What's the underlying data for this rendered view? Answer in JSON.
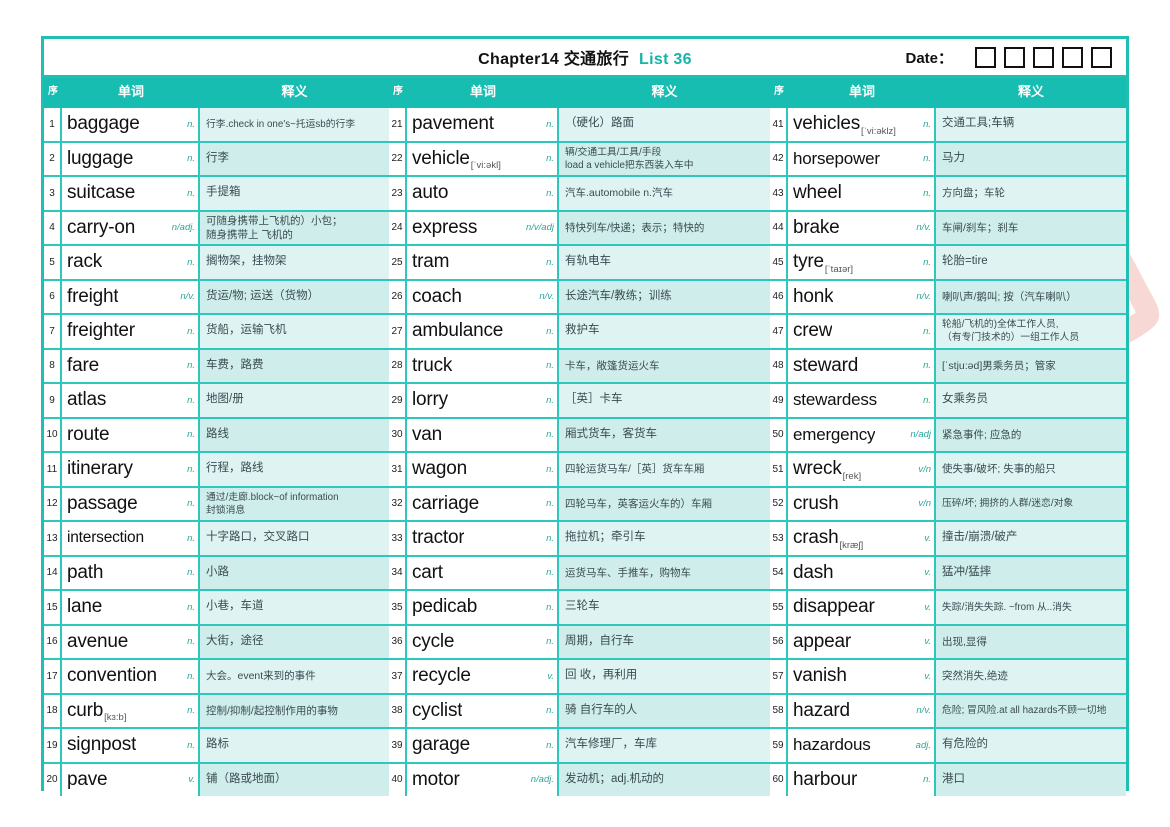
{
  "header": {
    "title_main": "Chapter14 交通旅行",
    "list_label": "List 36",
    "date_label": "Date：",
    "date_box_count": 5,
    "accent_color": "#16bdb0",
    "title_color": "#111111"
  },
  "column_headers": {
    "index": "序",
    "word": "单词",
    "definition": "释义"
  },
  "watermark": {
    "line1": "试用水印",
    "line2": "WPS"
  },
  "columns": [
    {
      "rows": [
        {
          "no": "1",
          "word": "baggage",
          "phonetic": "",
          "pos": "n.",
          "def": "行李.check in one's~托运sb的行李",
          "def_size": "tiny"
        },
        {
          "no": "2",
          "word": "luggage",
          "phonetic": "",
          "pos": "n.",
          "def": "行李",
          "def_size": ""
        },
        {
          "no": "3",
          "word": "suitcase",
          "phonetic": "",
          "pos": "n.",
          "def": "手提箱",
          "def_size": ""
        },
        {
          "no": "4",
          "word": "carry-on",
          "phonetic": "",
          "pos": "n/adj.",
          "def": "可随身携带上飞机的）小包；\n随身携带上 飞机的",
          "def_size": "small"
        },
        {
          "no": "5",
          "word": "rack",
          "phonetic": "",
          "pos": "n.",
          "def": "搁物架，挂物架",
          "def_size": ""
        },
        {
          "no": "6",
          "word": "freight",
          "phonetic": "",
          "pos": "n/v.",
          "def": "货运/物; 运送（货物）",
          "def_size": ""
        },
        {
          "no": "7",
          "word": "freighter",
          "phonetic": "",
          "pos": "n.",
          "def": "货船，运输飞机",
          "def_size": ""
        },
        {
          "no": "8",
          "word": "fare",
          "phonetic": "",
          "pos": "n.",
          "def": "车费，路费",
          "def_size": ""
        },
        {
          "no": "9",
          "word": "atlas",
          "phonetic": "",
          "pos": "n.",
          "def": "地图/册",
          "def_size": ""
        },
        {
          "no": "10",
          "word": "route",
          "phonetic": "",
          "pos": "n.",
          "def": "路线",
          "def_size": ""
        },
        {
          "no": "11",
          "word": "itinerary",
          "phonetic": "",
          "pos": "n.",
          "def": "行程，路线",
          "def_size": ""
        },
        {
          "no": "12",
          "word": "passage",
          "phonetic": "",
          "pos": "n.",
          "def": "通过/走廊.block~of information\n封锁消息",
          "def_size": "tiny"
        },
        {
          "no": "13",
          "word": "intersection",
          "phonetic": "",
          "pos": "n.",
          "def": "十字路口，交叉路口",
          "def_size": "",
          "word_size": "shrink2"
        },
        {
          "no": "14",
          "word": "path",
          "phonetic": "",
          "pos": "n.",
          "def": "小路",
          "def_size": ""
        },
        {
          "no": "15",
          "word": "lane",
          "phonetic": "",
          "pos": "n.",
          "def": "小巷，车道",
          "def_size": ""
        },
        {
          "no": "16",
          "word": "avenue",
          "phonetic": "",
          "pos": "n.",
          "def": "大街，途径",
          "def_size": ""
        },
        {
          "no": "17",
          "word": "convention",
          "phonetic": "",
          "pos": "n.",
          "def": "大会。event来到的事件",
          "def_size": "small"
        },
        {
          "no": "18",
          "word": "curb",
          "phonetic": "[kɜ:b]",
          "pos": "n.",
          "def": "控制/抑制/起控制作用的事物",
          "def_size": "small"
        },
        {
          "no": "19",
          "word": "signpost",
          "phonetic": "",
          "pos": "n.",
          "def": "路标",
          "def_size": ""
        },
        {
          "no": "20",
          "word": "pave",
          "phonetic": "",
          "pos": "v.",
          "def": "铺（路或地面）",
          "def_size": ""
        }
      ]
    },
    {
      "rows": [
        {
          "no": "21",
          "word": "pavement",
          "phonetic": "",
          "pos": "n.",
          "def": "（硬化）路面",
          "def_size": ""
        },
        {
          "no": "22",
          "word": "vehicle",
          "phonetic": "[ˈvi:əkl]",
          "pos": "n.",
          "def": "辆/交通工具/工具/手段\nload a vehicle把东西装入车中",
          "def_size": "tiny"
        },
        {
          "no": "23",
          "word": "auto",
          "phonetic": "",
          "pos": "n.",
          "def": "汽车.automobile n.汽车",
          "def_size": "small"
        },
        {
          "no": "24",
          "word": "express",
          "phonetic": "",
          "pos": "n/v/adj",
          "def": "特快列车/快递；表示；特快的",
          "def_size": "small"
        },
        {
          "no": "25",
          "word": "tram",
          "phonetic": "",
          "pos": "n.",
          "def": "有轨电车",
          "def_size": ""
        },
        {
          "no": "26",
          "word": "coach",
          "phonetic": "",
          "pos": "n/v.",
          "def": "长途汽车/教练；训练",
          "def_size": ""
        },
        {
          "no": "27",
          "word": "ambulance",
          "phonetic": "",
          "pos": "n.",
          "def": "救护车",
          "def_size": ""
        },
        {
          "no": "28",
          "word": "truck",
          "phonetic": "",
          "pos": "n.",
          "def": "卡车，敞篷货运火车",
          "def_size": "small"
        },
        {
          "no": "29",
          "word": "lorry",
          "phonetic": "",
          "pos": "n.",
          "def": "［英］卡车",
          "def_size": ""
        },
        {
          "no": "30",
          "word": "van",
          "phonetic": "",
          "pos": "n.",
          "def": "厢式货车，客货车",
          "def_size": ""
        },
        {
          "no": "31",
          "word": "wagon",
          "phonetic": "",
          "pos": "n.",
          "def": "四轮运货马车/［英］货车车厢",
          "def_size": "small"
        },
        {
          "no": "32",
          "word": "carriage",
          "phonetic": "",
          "pos": "n.",
          "def": "四轮马车，英客运火车的）车厢",
          "def_size": "small"
        },
        {
          "no": "33",
          "word": "tractor",
          "phonetic": "",
          "pos": "n.",
          "def": "拖拉机；牵引车",
          "def_size": ""
        },
        {
          "no": "34",
          "word": "cart",
          "phonetic": "",
          "pos": "n.",
          "def": "运货马车、手推车，购物车",
          "def_size": "small"
        },
        {
          "no": "35",
          "word": "pedicab",
          "phonetic": "",
          "pos": "n.",
          "def": "三轮车",
          "def_size": ""
        },
        {
          "no": "36",
          "word": "cycle",
          "phonetic": "",
          "pos": "n.",
          "def": "周期，自行车",
          "def_size": ""
        },
        {
          "no": "37",
          "word": "recycle",
          "phonetic": "",
          "pos": "v.",
          "def": "回 收，再利用",
          "def_size": ""
        },
        {
          "no": "38",
          "word": "cyclist",
          "phonetic": "",
          "pos": "n.",
          "def": "骑 自行车的人",
          "def_size": ""
        },
        {
          "no": "39",
          "word": "garage",
          "phonetic": "",
          "pos": "n.",
          "def": "汽车修理厂，车库",
          "def_size": ""
        },
        {
          "no": "40",
          "word": "motor",
          "phonetic": "",
          "pos": "n/adj.",
          "def": "发动机；adj.机动的",
          "def_size": ""
        }
      ]
    },
    {
      "rows": [
        {
          "no": "41",
          "word": "vehicles",
          "phonetic": "[ˈvi:əklz]",
          "pos": "n.",
          "def": "交通工具;车辆",
          "def_size": ""
        },
        {
          "no": "42",
          "word": "horsepower",
          "phonetic": "",
          "pos": "n.",
          "def": "马力",
          "def_size": "",
          "word_size": "shrink"
        },
        {
          "no": "43",
          "word": "wheel",
          "phonetic": "",
          "pos": "n.",
          "def": "方向盘；车轮",
          "def_size": "small"
        },
        {
          "no": "44",
          "word": "brake",
          "phonetic": "",
          "pos": "n/v.",
          "def": "车闸/刹车；刹车",
          "def_size": "small"
        },
        {
          "no": "45",
          "word": "tyre",
          "phonetic": "[ˈtaɪər]",
          "pos": "n.",
          "def": "轮胎=tire",
          "def_size": ""
        },
        {
          "no": "46",
          "word": "honk",
          "phonetic": "",
          "pos": "n/v.",
          "def": "喇叭声/鹅叫; 按（汽车喇叭）",
          "def_size": "small"
        },
        {
          "no": "47",
          "word": "crew",
          "phonetic": "",
          "pos": "n.",
          "def": "轮船/飞机的)全体工作人员,\n（有专门技术的）一组工作人员",
          "def_size": "tiny"
        },
        {
          "no": "48",
          "word": "steward",
          "phonetic": "",
          "pos": "n.",
          "def": "[ˈstju:əd]男乘务员；管家",
          "def_size": "small"
        },
        {
          "no": "49",
          "word": "stewardess",
          "phonetic": "",
          "pos": "n.",
          "def": "女乘务员",
          "def_size": "",
          "word_size": "shrink"
        },
        {
          "no": "50",
          "word": "emergency",
          "phonetic": "",
          "pos": "n/adj",
          "def": "紧急事件; 应急的",
          "def_size": "small",
          "word_size": "shrink"
        },
        {
          "no": "51",
          "word": "wreck",
          "phonetic": "[rek]",
          "pos": "v/n",
          "def": "使失事/破坏; 失事的船只",
          "def_size": "small"
        },
        {
          "no": "52",
          "word": "crush",
          "phonetic": "",
          "pos": "v/n",
          "def": "压碎/坏; 拥挤的人群/迷恋/对象",
          "def_size": "tiny"
        },
        {
          "no": "53",
          "word": "crash",
          "phonetic": "[kræʃ]",
          "pos": "v.",
          "def": "撞击/崩溃/破产",
          "def_size": ""
        },
        {
          "no": "54",
          "word": "dash",
          "phonetic": "",
          "pos": "v.",
          "def": "猛冲/猛摔",
          "def_size": ""
        },
        {
          "no": "55",
          "word": "disappear",
          "phonetic": "",
          "pos": "v.",
          "def": "失踪/消失失踪. ~from 从..消失",
          "def_size": "tiny"
        },
        {
          "no": "56",
          "word": "appear",
          "phonetic": "",
          "pos": "v.",
          "def": "出现,显得",
          "def_size": "small"
        },
        {
          "no": "57",
          "word": "vanish",
          "phonetic": "",
          "pos": "v.",
          "def": "突然消失,绝迹",
          "def_size": "small"
        },
        {
          "no": "58",
          "word": "hazard",
          "phonetic": "",
          "pos": "n/v.",
          "def": "危险; 冒风险.at all hazards不顾一切地",
          "def_size": "tiny"
        },
        {
          "no": "59",
          "word": "hazardous",
          "phonetic": "",
          "pos": "adj.",
          "def": "有危险的",
          "def_size": "",
          "word_size": "shrink"
        },
        {
          "no": "60",
          "word": "harbour",
          "phonetic": "",
          "pos": "n.",
          "def": "港口",
          "def_size": ""
        }
      ]
    }
  ]
}
